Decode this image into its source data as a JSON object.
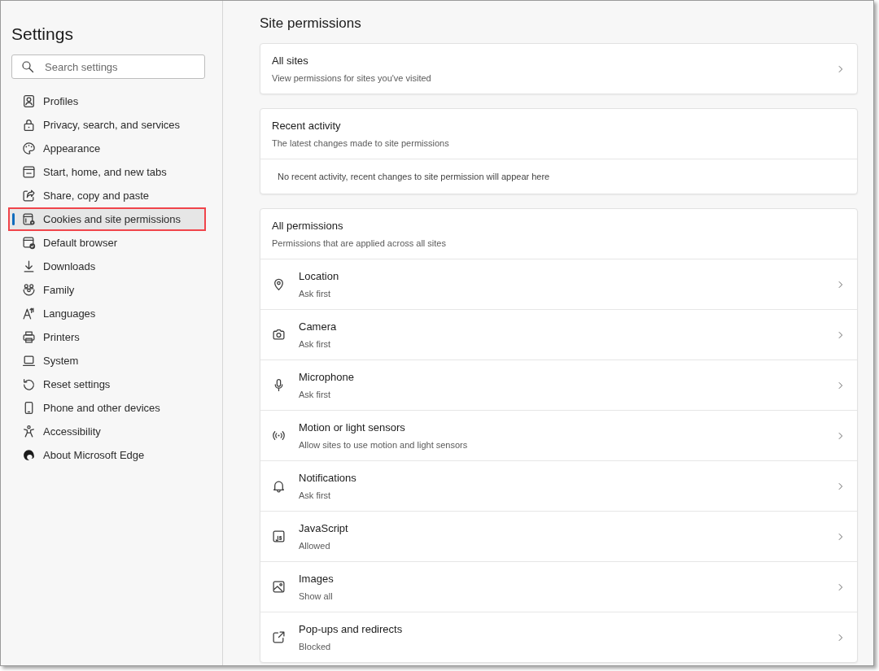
{
  "sidebar": {
    "title": "Settings",
    "search": {
      "placeholder": "Search settings"
    },
    "items": [
      {
        "label": "Profiles",
        "selected": false
      },
      {
        "label": "Privacy, search, and services",
        "selected": false
      },
      {
        "label": "Appearance",
        "selected": false
      },
      {
        "label": "Start, home, and new tabs",
        "selected": false
      },
      {
        "label": "Share, copy and paste",
        "selected": false
      },
      {
        "label": "Cookies and site permissions",
        "selected": true
      },
      {
        "label": "Default browser",
        "selected": false
      },
      {
        "label": "Downloads",
        "selected": false
      },
      {
        "label": "Family",
        "selected": false
      },
      {
        "label": "Languages",
        "selected": false
      },
      {
        "label": "Printers",
        "selected": false
      },
      {
        "label": "System",
        "selected": false
      },
      {
        "label": "Reset settings",
        "selected": false
      },
      {
        "label": "Phone and other devices",
        "selected": false
      },
      {
        "label": "Accessibility",
        "selected": false
      },
      {
        "label": "About Microsoft Edge",
        "selected": false
      }
    ]
  },
  "main": {
    "title": "Site permissions",
    "all_sites": {
      "title": "All sites",
      "description": "View permissions for sites you've visited"
    },
    "recent_activity": {
      "title": "Recent activity",
      "description": "The latest changes made to site permissions",
      "empty_message": "No recent activity, recent changes to site permission will appear here"
    },
    "all_permissions": {
      "title": "All permissions",
      "description": "Permissions that are applied across all sites",
      "items": [
        {
          "label": "Location",
          "value": "Ask first"
        },
        {
          "label": "Camera",
          "value": "Ask first"
        },
        {
          "label": "Microphone",
          "value": "Ask first"
        },
        {
          "label": "Motion or light sensors",
          "value": "Allow sites to use motion and light sensors"
        },
        {
          "label": "Notifications",
          "value": "Ask first"
        },
        {
          "label": "JavaScript",
          "value": "Allowed"
        },
        {
          "label": "Images",
          "value": "Show all"
        },
        {
          "label": "Pop-ups and redirects",
          "value": "Blocked"
        }
      ]
    }
  }
}
